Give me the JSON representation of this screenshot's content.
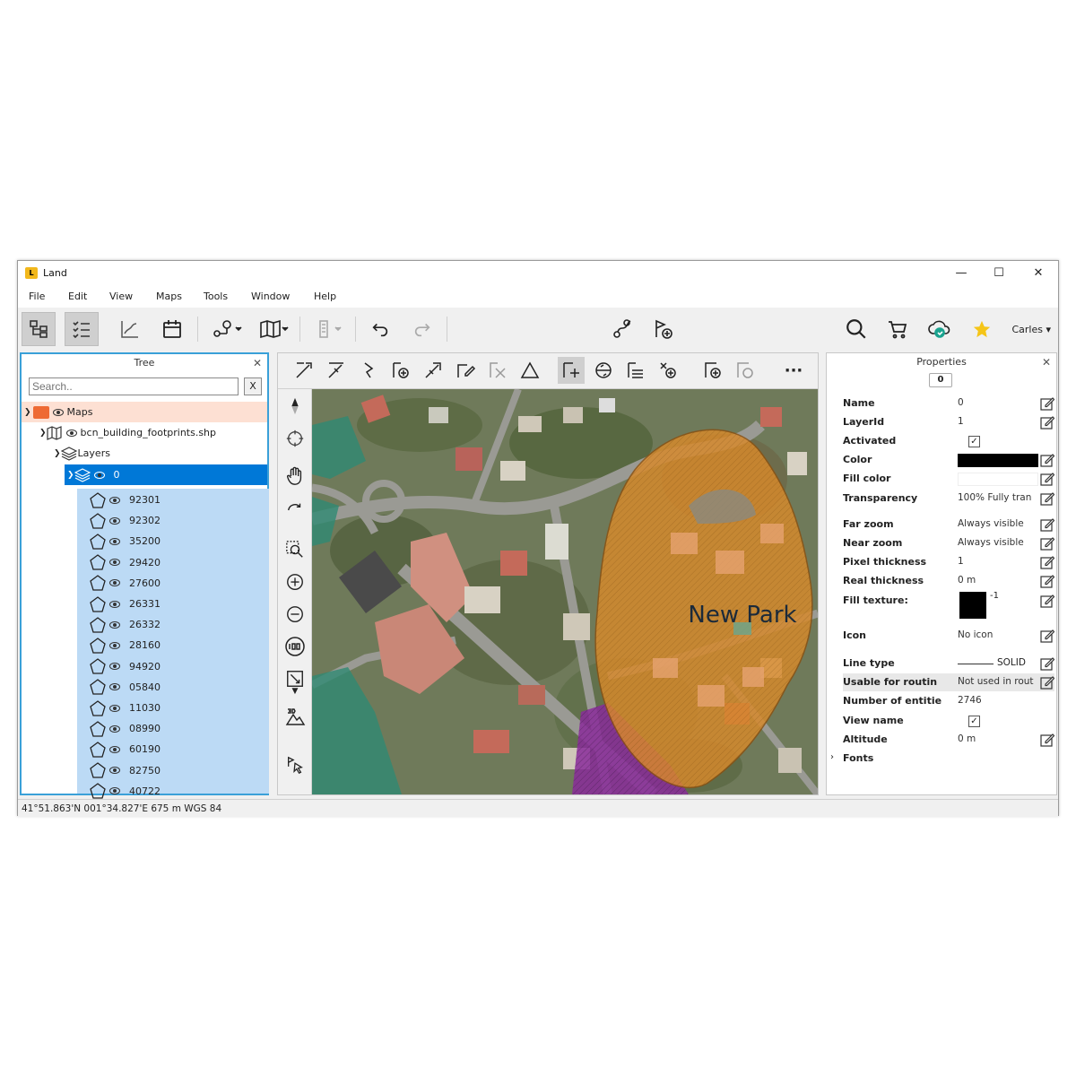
{
  "window": {
    "title": "Land",
    "logo_text": "L",
    "controls": {
      "minimize": "—",
      "maximize": "☐",
      "close": "✕"
    }
  },
  "menu": [
    "File",
    "Edit",
    "View",
    "Maps",
    "Tools",
    "Window",
    "Help"
  ],
  "toolbar": {
    "user": "Carles ▾",
    "icons": [
      "tree-icon",
      "checklist-icon",
      "chart-icon",
      "calendar-icon",
      "route-icon",
      "map-icon",
      "layer-stack-icon",
      "undo-icon",
      "redo-icon",
      "gps-track-icon",
      "waypoint-add-icon",
      "search-icon",
      "cart-icon",
      "cloud-sync-icon",
      "star-icon"
    ],
    "accent_star": "#f5c518"
  },
  "tree": {
    "title": "Tree",
    "close": "✕",
    "search_placeholder": "Search..",
    "clear_label": "X",
    "maps_label": "Maps",
    "file_label": "bcn_building_footprints.shp",
    "layers_label": "Layers",
    "layer_label": "0",
    "features": [
      "92301",
      "92302",
      "35200",
      "29420",
      "27600",
      "26331",
      "26332",
      "28160",
      "94920",
      "05840",
      "11030",
      "08990",
      "60190",
      "82750",
      "40722"
    ],
    "selected_color": "#0078d7",
    "maps_row_color": "#fde0d3",
    "features_bg": "#bcdaf5"
  },
  "map": {
    "label": "New Park",
    "park_color": "#d98a2b",
    "purple_area": "#8a2c9a",
    "green_area": "#2f8a73"
  },
  "properties": {
    "title": "Properties",
    "close": "✕",
    "index": "0",
    "rows": [
      {
        "name": "Name",
        "value": "0"
      },
      {
        "name": "LayerId",
        "value": "1"
      },
      {
        "name": "Activated",
        "value": ""
      },
      {
        "name": "Color",
        "value": ""
      },
      {
        "name": "Fill color",
        "value": ""
      },
      {
        "name": "Transparency",
        "value": "100% Fully tran"
      },
      {
        "name": "Far zoom",
        "value": "Always visible"
      },
      {
        "name": "Near zoom",
        "value": "Always visible"
      },
      {
        "name": "Pixel thickness",
        "value": "1"
      },
      {
        "name": "Real thickness",
        "value": "0 m"
      },
      {
        "name": "Fill texture:",
        "value": "-1"
      },
      {
        "name": "Icon",
        "value": "No icon"
      },
      {
        "name": "Line type",
        "value": "SOLID"
      },
      {
        "name": "Usable for routin",
        "value": "Not used in rout"
      },
      {
        "name": "Number of entitie",
        "value": "2746"
      },
      {
        "name": "View name",
        "value": ""
      },
      {
        "name": "Altitude",
        "value": "0 m"
      },
      {
        "name": "Fonts",
        "value": ""
      }
    ]
  },
  "status": {
    "coords": "41°51.863'N 001°34.827'E  675 m  WGS 84"
  }
}
